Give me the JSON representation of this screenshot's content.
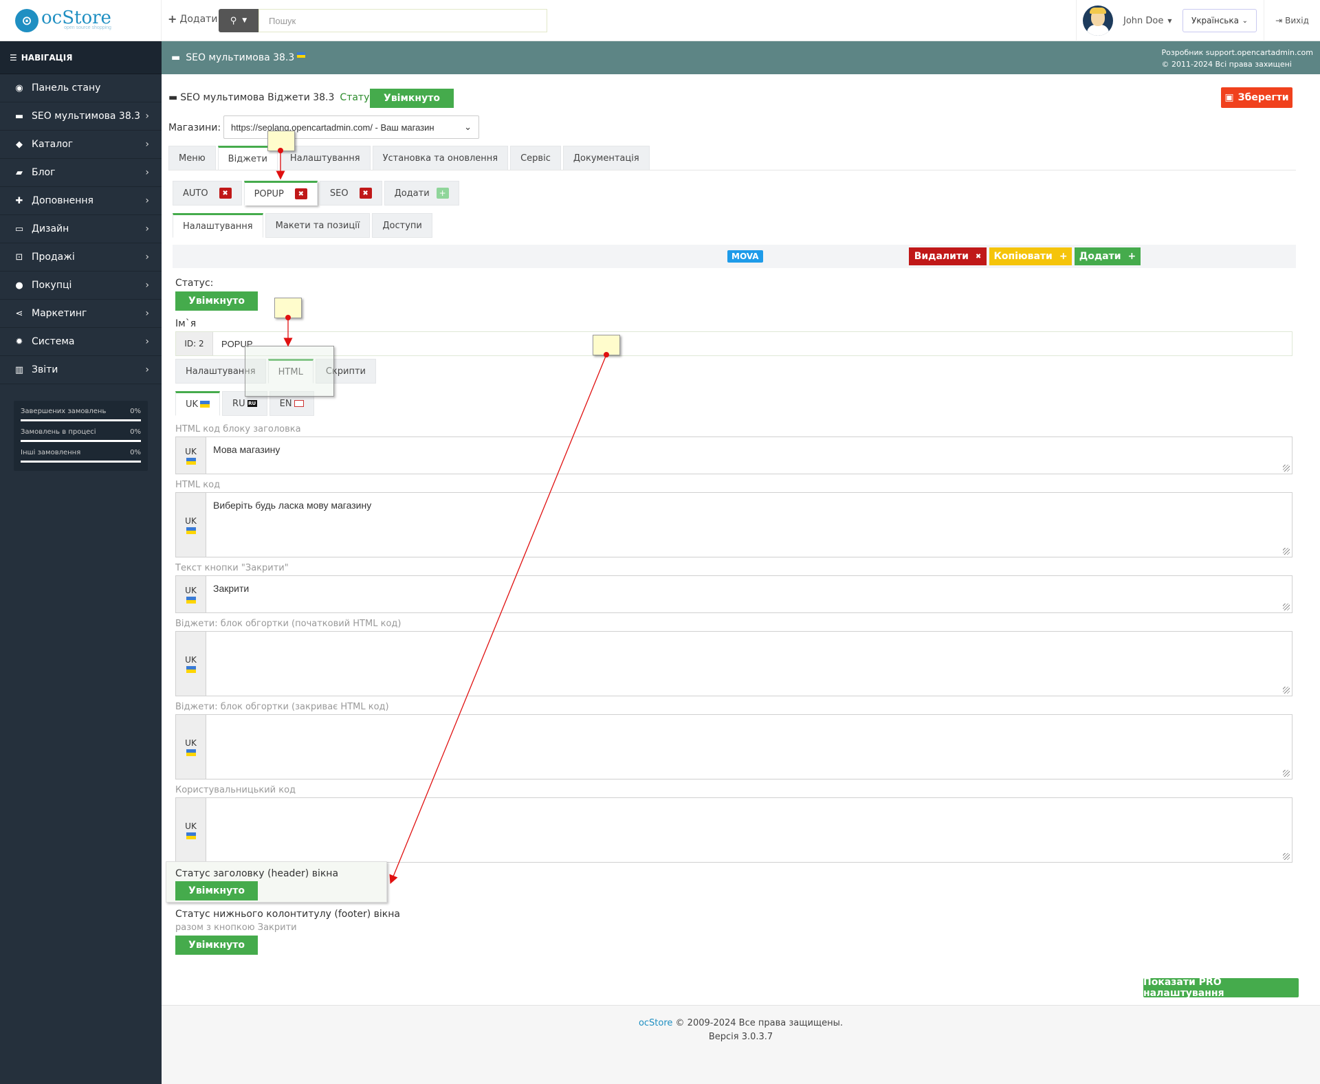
{
  "header": {
    "logo_text": "ocStore",
    "logo_tagline": "open source shopping",
    "add_label": "Додати",
    "search_placeholder": "Пошук",
    "user_name": "John Doe",
    "language": "Українська",
    "logout_label": "Вихід"
  },
  "sidebar": {
    "title": "НАВІГАЦІЯ",
    "items": [
      {
        "label": "Панель стану",
        "icon": "dashboard-icon"
      },
      {
        "label": "SEO мультимова 38.3",
        "icon": "window-icon"
      },
      {
        "label": "Каталог",
        "icon": "tags-icon"
      },
      {
        "label": "Блог",
        "icon": "book-icon"
      },
      {
        "label": "Доповнення",
        "icon": "puzzle-icon"
      },
      {
        "label": "Дизайн",
        "icon": "monitor-icon"
      },
      {
        "label": "Продажі",
        "icon": "cart-icon"
      },
      {
        "label": "Покупці",
        "icon": "user-icon"
      },
      {
        "label": "Маркетинг",
        "icon": "share-icon"
      },
      {
        "label": "Система",
        "icon": "gear-icon"
      },
      {
        "label": "Звіти",
        "icon": "chart-icon"
      }
    ],
    "stats": [
      {
        "label": "Завершених замовлень",
        "value": "0%"
      },
      {
        "label": "Замовлень в процесі",
        "value": "0%"
      },
      {
        "label": "Інші замовлення",
        "value": "0%"
      }
    ]
  },
  "breadcrumb": {
    "title": "SEO мультимова 38.3",
    "dev_line": "Розробник support.opencartadmin.com",
    "copyright_line": "© 2011-2024 Всі права захищені"
  },
  "module": {
    "title": "SEO мультимова Віджети 38.3",
    "status_label": "Статус",
    "status_value": "Увімкнуто",
    "save_label": "Зберегти",
    "store_label": "Магазини:",
    "store_value": "https://seolang.opencartadmin.com/ - Ваш магазин"
  },
  "main_tabs": [
    "Меню",
    "Віджети",
    "Налаштування",
    "Установка та оновлення",
    "Сервіс",
    "Документація"
  ],
  "widget_tabs": [
    "AUTO",
    "POPUP",
    "SEO",
    "Додати"
  ],
  "sub_tabs": [
    "Налаштування",
    "Макети та позиції",
    "Доступи"
  ],
  "toolbar": {
    "badge": "MOVA",
    "delete_label": "Видалити",
    "copy_label": "Копіювати",
    "add_label": "Додати"
  },
  "form": {
    "status_label": "Статус:",
    "status_value": "Увімкнуто",
    "name_label": "Ім`я",
    "id_prefix": "ID: 2",
    "name_value": "POPUP",
    "inner_tabs": [
      "Налаштування",
      "HTML",
      "Скрипти"
    ],
    "lang_tabs": [
      "UK",
      "RU",
      "EN"
    ],
    "fields": [
      {
        "label": "HTML код блоку заголовка",
        "lang": "UK",
        "value": "Мова магазину"
      },
      {
        "label": "HTML код",
        "lang": "UK",
        "value": "Виберіть будь ласка мову магазину"
      },
      {
        "label": "Текст кнопки \"Закрити\"",
        "lang": "UK",
        "value": "Закрити"
      },
      {
        "label": "Віджети: блок обгортки (початковий HTML код)",
        "lang": "UK",
        "value": ""
      },
      {
        "label": "Віджети: блок обгортки (закриває HTML код)",
        "lang": "UK",
        "value": ""
      },
      {
        "label": "Користувальницький код",
        "lang": "UK",
        "value": ""
      }
    ],
    "header_status_label": "Статус заголовку (header) вікна",
    "header_status_value": "Увімкнуто",
    "footer_status_label": "Статус нижнього колонтитулу (footer) вікна",
    "footer_status_hint": "разом з кнопкою Закрити",
    "footer_status_value": "Увімкнуто",
    "pro_button": "Показати PRO налаштування"
  },
  "footer": {
    "brand": "ocStore",
    "copyright": "© 2009-2024 Все права защищены.",
    "version": "Версія 3.0.3.7"
  },
  "colors": {
    "sidebar": "#25303c",
    "breadcrumb": "#5d8585",
    "green": "#45ab4c",
    "save": "#f0411d",
    "delete": "#c01818",
    "copy": "#f5c40a",
    "badge": "#1e9be9",
    "annotation_arrow": "#e01010"
  }
}
